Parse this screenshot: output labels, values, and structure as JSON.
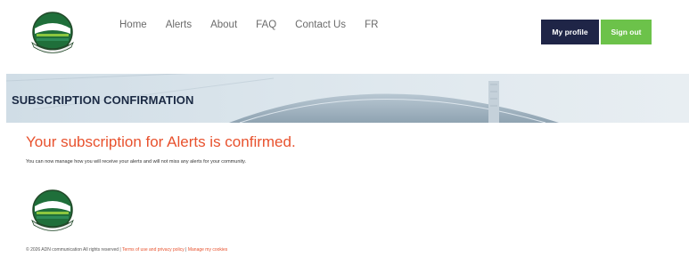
{
  "header": {
    "logo_icon": "ormstown-crest-logo",
    "nav": [
      "Home",
      "Alerts",
      "About",
      "FAQ",
      "Contact Us",
      "FR"
    ],
    "my_profile_label": "My profile",
    "sign_out_label": "Sign out"
  },
  "banner": {
    "title": "SUBSCRIPTION CONFIRMATION"
  },
  "main": {
    "headline": "Your subscription for Alerts is confirmed.",
    "subtext": "You can now manage how you will receive your alerts and will not miss any alerts for your community."
  },
  "footer": {
    "logo_icon": "ormstown-crest-logo",
    "copyright": "© 2026 ADN communication All rights reserved | ",
    "terms_link": "Terms of use and privacy policy",
    "separator": " | ",
    "cookies_link": "Manage my cookies"
  },
  "colors": {
    "accent": "#e8522e",
    "navy": "#1f2547",
    "green": "#6cc24a"
  }
}
